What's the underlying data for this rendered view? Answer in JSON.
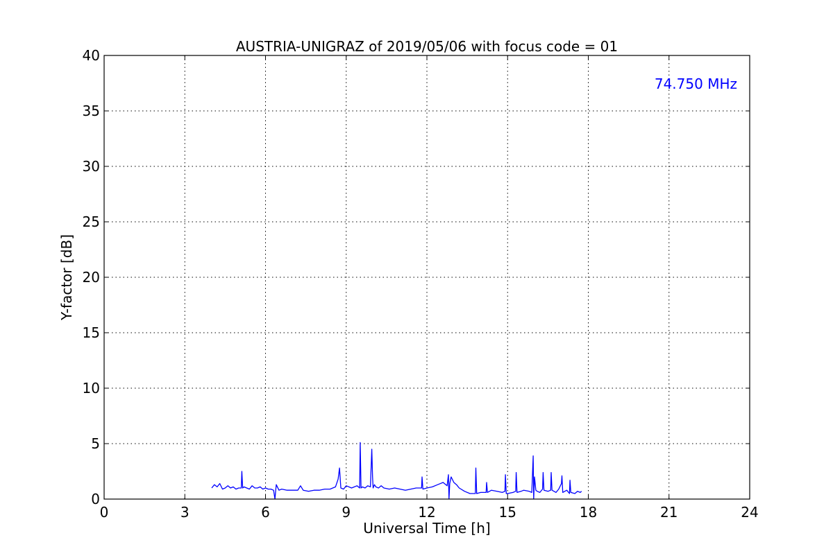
{
  "chart_data": {
    "type": "line",
    "title": "AUSTRIA-UNIGRAZ of 2019/05/06 with focus code = 01",
    "xlabel": "Universal Time [h]",
    "ylabel": "Y-factor [dB]",
    "xlim": [
      0,
      24
    ],
    "ylim": [
      0,
      40
    ],
    "xticks": [
      0,
      3,
      6,
      9,
      12,
      15,
      18,
      21,
      24
    ],
    "yticks": [
      0,
      5,
      10,
      15,
      20,
      25,
      30,
      35,
      40
    ],
    "xtick_labels": [
      "0",
      "3",
      "6",
      "9",
      "12",
      "15",
      "18",
      "21",
      "24"
    ],
    "ytick_labels": [
      "0",
      "5",
      "10",
      "15",
      "20",
      "25",
      "30",
      "35",
      "40"
    ],
    "grid": true,
    "annotation": {
      "text": "74.750 MHz",
      "color": "#0000ff",
      "placement": "top-right"
    },
    "series": [
      {
        "color": "#0000ff",
        "x": [
          4.0,
          4.1,
          4.2,
          4.3,
          4.4,
          4.5,
          4.6,
          4.7,
          4.8,
          4.9,
          5.0,
          5.1,
          5.12,
          5.15,
          5.2,
          5.3,
          5.4,
          5.5,
          5.6,
          5.7,
          5.8,
          5.9,
          6.0,
          6.1,
          6.2,
          6.3,
          6.35,
          6.38,
          6.4,
          6.5,
          6.6,
          6.8,
          7.0,
          7.2,
          7.3,
          7.4,
          7.6,
          7.8,
          8.0,
          8.2,
          8.4,
          8.6,
          8.7,
          8.75,
          8.8,
          8.9,
          9.0,
          9.2,
          9.4,
          9.5,
          9.52,
          9.55,
          9.6,
          9.7,
          9.8,
          9.9,
          9.95,
          9.98,
          10.0,
          10.05,
          10.1,
          10.2,
          10.3,
          10.4,
          10.6,
          10.8,
          11.0,
          11.2,
          11.4,
          11.6,
          11.8,
          11.82,
          11.85,
          12.0,
          12.2,
          12.4,
          12.6,
          12.75,
          12.8,
          12.82,
          12.85,
          12.9,
          13.0,
          13.1,
          13.2,
          13.4,
          13.6,
          13.8,
          13.82,
          13.85,
          14.0,
          14.2,
          14.22,
          14.25,
          14.4,
          14.6,
          14.8,
          14.9,
          14.92,
          14.95,
          15.0,
          15.2,
          15.3,
          15.32,
          15.35,
          15.5,
          15.6,
          15.8,
          15.9,
          15.95,
          15.97,
          16.0,
          16.05,
          16.1,
          16.2,
          16.3,
          16.32,
          16.35,
          16.5,
          16.6,
          16.62,
          16.65,
          16.8,
          16.9,
          17.0,
          17.02,
          17.05,
          17.2,
          17.3,
          17.32,
          17.35,
          17.5,
          17.6,
          17.7,
          17.75
        ],
        "y": [
          1.0,
          1.3,
          1.1,
          1.4,
          0.9,
          1.0,
          1.2,
          1.0,
          1.1,
          0.9,
          1.0,
          1.0,
          2.5,
          1.0,
          1.1,
          1.0,
          0.9,
          1.2,
          1.0,
          1.0,
          1.1,
          0.9,
          1.0,
          0.9,
          0.9,
          0.8,
          0.0,
          0.8,
          1.3,
          0.8,
          0.9,
          0.8,
          0.8,
          0.8,
          1.2,
          0.8,
          0.7,
          0.8,
          0.8,
          0.9,
          0.9,
          1.1,
          1.8,
          2.8,
          1.0,
          0.9,
          1.2,
          1.0,
          1.2,
          1.0,
          5.1,
          1.0,
          1.1,
          1.0,
          1.2,
          1.1,
          4.5,
          2.0,
          1.0,
          1.3,
          1.1,
          1.0,
          1.2,
          1.0,
          0.9,
          1.0,
          0.9,
          0.8,
          0.9,
          1.0,
          1.0,
          2.0,
          0.9,
          1.0,
          1.1,
          1.3,
          1.5,
          1.2,
          2.2,
          0.0,
          1.4,
          2.0,
          1.5,
          1.3,
          1.0,
          0.7,
          0.5,
          0.5,
          2.8,
          0.5,
          0.6,
          0.6,
          1.5,
          0.6,
          0.8,
          0.7,
          0.6,
          0.7,
          2.2,
          0.5,
          0.5,
          0.6,
          0.7,
          2.4,
          0.6,
          0.7,
          0.8,
          0.7,
          0.6,
          3.9,
          0.0,
          2.0,
          0.8,
          0.7,
          0.6,
          0.9,
          2.4,
          0.8,
          0.7,
          0.8,
          2.4,
          0.8,
          0.6,
          0.9,
          1.4,
          2.1,
          0.6,
          0.8,
          0.5,
          1.7,
          0.6,
          0.5,
          0.7,
          0.6,
          0.7
        ]
      }
    ]
  }
}
